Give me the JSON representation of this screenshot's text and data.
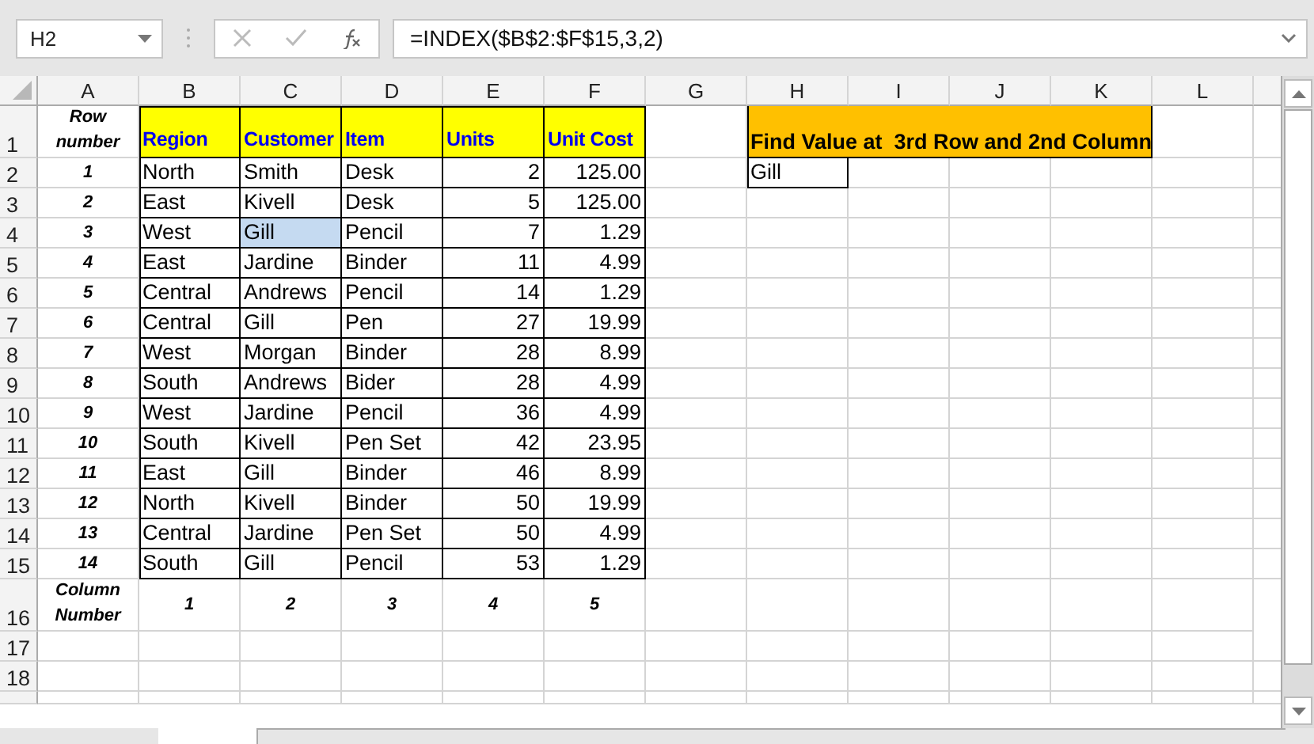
{
  "name_box": "H2",
  "formula": "=INDEX($B$2:$F$15,3,2)",
  "columns": [
    "A",
    "B",
    "C",
    "D",
    "E",
    "F",
    "G",
    "H",
    "I",
    "J",
    "K",
    "L"
  ],
  "header_row": {
    "row": "1",
    "label": "Row number",
    "fields": [
      {
        "label": "Region",
        "kind": "text"
      },
      {
        "label": "Customer",
        "kind": "text"
      },
      {
        "label": "Item",
        "kind": "text"
      },
      {
        "label": "Units",
        "kind": "number"
      },
      {
        "label": "Unit Cost",
        "kind": "number"
      }
    ]
  },
  "records": [
    {
      "row": "2",
      "index": "1",
      "cells": [
        {
          "text": "North",
          "highlighted": false
        },
        {
          "text": "Smith",
          "highlighted": false
        },
        {
          "text": "Desk",
          "highlighted": false
        },
        {
          "text": "2",
          "highlighted": false
        },
        {
          "text": "125.00",
          "highlighted": false
        }
      ]
    },
    {
      "row": "3",
      "index": "2",
      "cells": [
        {
          "text": "East",
          "highlighted": false
        },
        {
          "text": "Kivell",
          "highlighted": false
        },
        {
          "text": "Desk",
          "highlighted": false
        },
        {
          "text": "5",
          "highlighted": false
        },
        {
          "text": "125.00",
          "highlighted": false
        }
      ]
    },
    {
      "row": "4",
      "index": "3",
      "cells": [
        {
          "text": "West",
          "highlighted": false
        },
        {
          "text": "Gill",
          "highlighted": true
        },
        {
          "text": "Pencil",
          "highlighted": false
        },
        {
          "text": "7",
          "highlighted": false
        },
        {
          "text": "1.29",
          "highlighted": false
        }
      ]
    },
    {
      "row": "5",
      "index": "4",
      "cells": [
        {
          "text": "East",
          "highlighted": false
        },
        {
          "text": "Jardine",
          "highlighted": false
        },
        {
          "text": "Binder",
          "highlighted": false
        },
        {
          "text": "11",
          "highlighted": false
        },
        {
          "text": "4.99",
          "highlighted": false
        }
      ]
    },
    {
      "row": "6",
      "index": "5",
      "cells": [
        {
          "text": "Central",
          "highlighted": false
        },
        {
          "text": "Andrews",
          "highlighted": false
        },
        {
          "text": "Pencil",
          "highlighted": false
        },
        {
          "text": "14",
          "highlighted": false
        },
        {
          "text": "1.29",
          "highlighted": false
        }
      ]
    },
    {
      "row": "7",
      "index": "6",
      "cells": [
        {
          "text": "Central",
          "highlighted": false
        },
        {
          "text": "Gill",
          "highlighted": false
        },
        {
          "text": "Pen",
          "highlighted": false
        },
        {
          "text": "27",
          "highlighted": false
        },
        {
          "text": "19.99",
          "highlighted": false
        }
      ]
    },
    {
      "row": "8",
      "index": "7",
      "cells": [
        {
          "text": "West",
          "highlighted": false
        },
        {
          "text": "Morgan",
          "highlighted": false
        },
        {
          "text": "Binder",
          "highlighted": false
        },
        {
          "text": "28",
          "highlighted": false
        },
        {
          "text": "8.99",
          "highlighted": false
        }
      ]
    },
    {
      "row": "9",
      "index": "8",
      "cells": [
        {
          "text": "South",
          "highlighted": false
        },
        {
          "text": "Andrews",
          "highlighted": false
        },
        {
          "text": "Bider",
          "highlighted": false
        },
        {
          "text": "28",
          "highlighted": false
        },
        {
          "text": "4.99",
          "highlighted": false
        }
      ]
    },
    {
      "row": "10",
      "index": "9",
      "cells": [
        {
          "text": "West",
          "highlighted": false
        },
        {
          "text": "Jardine",
          "highlighted": false
        },
        {
          "text": "Pencil",
          "highlighted": false
        },
        {
          "text": "36",
          "highlighted": false
        },
        {
          "text": "4.99",
          "highlighted": false
        }
      ]
    },
    {
      "row": "11",
      "index": "10",
      "cells": [
        {
          "text": "South",
          "highlighted": false
        },
        {
          "text": "Kivell",
          "highlighted": false
        },
        {
          "text": "Pen Set",
          "highlighted": false
        },
        {
          "text": "42",
          "highlighted": false
        },
        {
          "text": "23.95",
          "highlighted": false
        }
      ]
    },
    {
      "row": "12",
      "index": "11",
      "cells": [
        {
          "text": "East",
          "highlighted": false
        },
        {
          "text": "Gill",
          "highlighted": false
        },
        {
          "text": "Binder",
          "highlighted": false
        },
        {
          "text": "46",
          "highlighted": false
        },
        {
          "text": "8.99",
          "highlighted": false
        }
      ]
    },
    {
      "row": "13",
      "index": "12",
      "cells": [
        {
          "text": "North",
          "highlighted": false
        },
        {
          "text": "Kivell",
          "highlighted": false
        },
        {
          "text": "Binder",
          "highlighted": false
        },
        {
          "text": "50",
          "highlighted": false
        },
        {
          "text": "19.99",
          "highlighted": false
        }
      ]
    },
    {
      "row": "14",
      "index": "13",
      "cells": [
        {
          "text": "Central",
          "highlighted": false
        },
        {
          "text": "Jardine",
          "highlighted": false
        },
        {
          "text": "Pen Set",
          "highlighted": false
        },
        {
          "text": "50",
          "highlighted": false
        },
        {
          "text": "4.99",
          "highlighted": false
        }
      ]
    },
    {
      "row": "15",
      "index": "14",
      "cells": [
        {
          "text": "South",
          "highlighted": false
        },
        {
          "text": "Gill",
          "highlighted": false
        },
        {
          "text": "Pencil",
          "highlighted": false
        },
        {
          "text": "53",
          "highlighted": false
        },
        {
          "text": "1.29",
          "highlighted": false
        }
      ]
    }
  ],
  "footer_row": {
    "row": "16",
    "label": "Column Number",
    "numbers": [
      "1",
      "2",
      "3",
      "4",
      "5"
    ]
  },
  "empty_rows": [
    "17",
    "18"
  ],
  "result": {
    "title": "Find Value at  3rd Row and 2nd Column",
    "value": "Gill"
  }
}
